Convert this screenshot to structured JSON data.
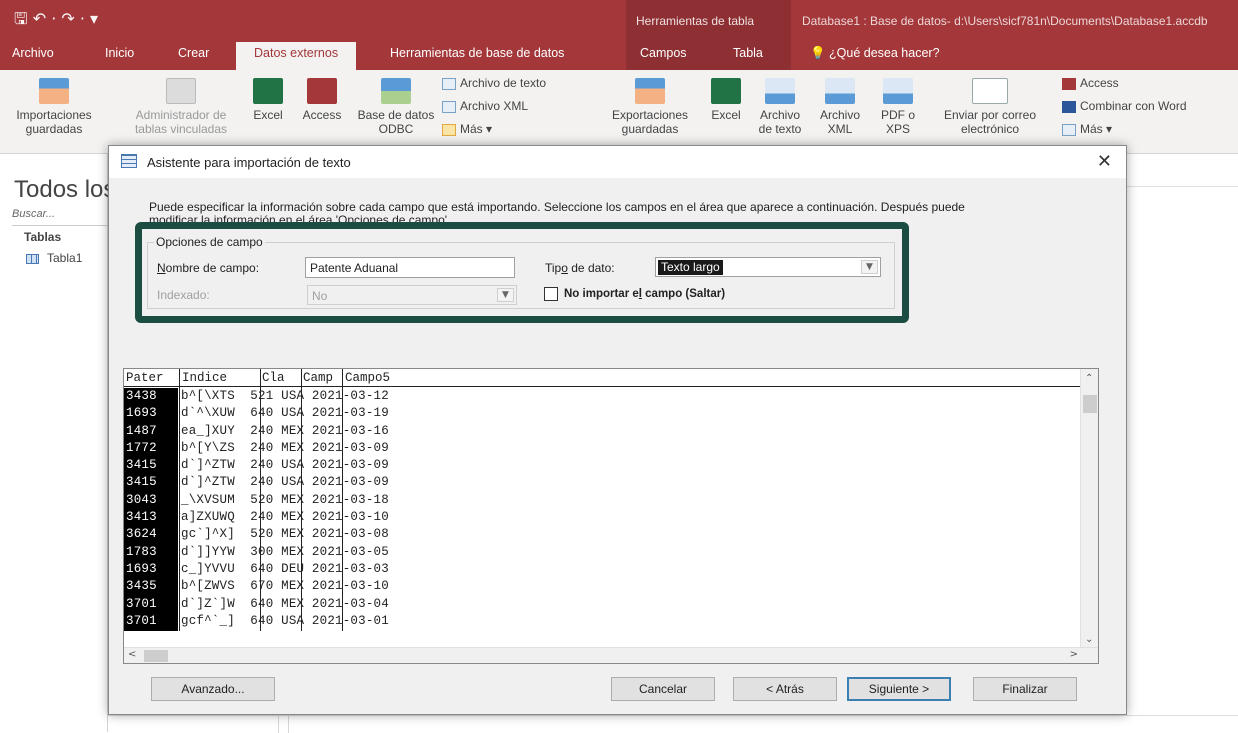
{
  "window": {
    "quick_access": "🖫  ↶ · ↷ ·  ▾",
    "context_group": "Herramientas de tabla",
    "title": "Database1 : Base de datos- d:\\Users\\sicf781n\\Documents\\Database1.accdb"
  },
  "tabs": [
    "Archivo",
    "Inicio",
    "Crear",
    "Datos externos",
    "Herramientas de base de datos",
    "Campos",
    "Tabla",
    "💡 ¿Qué desea hacer?"
  ],
  "ribbon": {
    "import_saved": "Importaciones guardadas",
    "linked_mgr": "Administrador de tablas vinculadas",
    "excel_import": "Excel",
    "access_import": "Access",
    "odbc": "Base de datos ODBC",
    "text_file": "Archivo de texto",
    "xml_file": "Archivo XML",
    "more_import": "Más ▾",
    "export_saved": "Exportaciones guardadas",
    "excel_export": "Excel",
    "text_export": "Archivo de texto",
    "xml_export": "Archivo XML",
    "pdf_export": "PDF o XPS",
    "email": "Enviar por correo electrónico",
    "access_export": "Access",
    "word_merge": "Combinar con Word",
    "more_export": "Más ▾"
  },
  "nav": {
    "title": "Todos los",
    "search": "Buscar...",
    "section": "Tablas",
    "item": "Tabla1"
  },
  "dialog": {
    "title": "Asistente para importación de texto",
    "close": "✕",
    "instructions": "Puede especificar la información sobre cada campo que está importando. Seleccione los campos en el área que aparece a continuación. Después puede modificar la información en el área 'Opciones de campo'.",
    "group_label": "Opciones de campo",
    "field_name_label_u": "N",
    "field_name_label": "ombre de campo:",
    "field_name_value": "Patente Aduanal",
    "data_type_label_pre": "Tip",
    "data_type_label_u": "o",
    "data_type_label_post": " de dato:",
    "data_type_value": "Texto largo",
    "indexed_label": "Indexado:",
    "indexed_value": "No",
    "skip_label_pre": "No importar e",
    "skip_label_u": "l",
    "skip_label_post": " campo (Saltar)",
    "columns": [
      "Pater",
      "Indice",
      "Cla",
      "Camp",
      "Campo5"
    ],
    "col1_rows": "3438\n1693\n1487\n1772\n3415\n3415\n3043\n3413\n3624\n1783\n1693\n3435\n3701\n3701",
    "rest_rows": "b^[\\XTS  521 USA 2021-03-12\nd`^\\XUW  640 USA 2021-03-19\nea_]XUY  240 MEX 2021-03-16\nb^[Y\\ZS  240 MEX 2021-03-09\nd`]^ZTW  240 USA 2021-03-09\nd`]^ZTW  240 USA 2021-03-09\n_\\XVSUM  520 MEX 2021-03-18\na]ZXUWQ  240 MEX 2021-03-10\ngc`]^X]  520 MEX 2021-03-08\nd`]]YYW  300 MEX 2021-03-05\nc_]YVVU  640 DEU 2021-03-03\nb^[ZWVS  670 MEX 2021-03-10\nd`]Z`]W  640 MEX 2021-03-04\ngcf^`_]  640 USA 2021-03-01",
    "btn_advanced": "Avanzado...",
    "btn_cancel": "Cancelar",
    "btn_back": "< Atrás",
    "btn_next": "Siguiente >",
    "btn_finish": "Finalizar"
  },
  "colors": {
    "accent": "#a4373a",
    "highlight_frame": "#1c4d42"
  }
}
